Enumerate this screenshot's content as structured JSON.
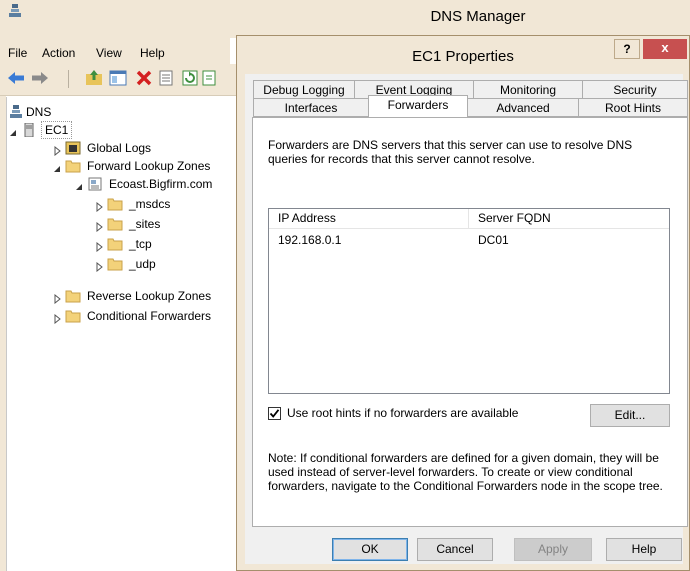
{
  "main_window": {
    "title": "DNS Manager",
    "menu": [
      "File",
      "Action",
      "View",
      "Help"
    ],
    "tree": {
      "root": "DNS",
      "server": "EC1",
      "nodes": [
        {
          "label": "Global Logs",
          "icon": "global-logs-icon"
        },
        {
          "label": "Forward Lookup Zones",
          "icon": "folder-icon"
        },
        {
          "label": "Ecoast.Bigfirm.com",
          "icon": "zone-icon"
        },
        {
          "label": "_msdcs",
          "icon": "folder-icon"
        },
        {
          "label": "_sites",
          "icon": "folder-icon"
        },
        {
          "label": "_tcp",
          "icon": "folder-icon"
        },
        {
          "label": "_udp",
          "icon": "folder-icon"
        },
        {
          "label": "Reverse Lookup Zones",
          "icon": "folder-icon"
        },
        {
          "label": "Conditional Forwarders",
          "icon": "folder-icon"
        }
      ]
    }
  },
  "dialog": {
    "title": "EC1 Properties",
    "help_glyph": "?",
    "close_glyph": "x",
    "tabs_top": [
      "Debug Logging",
      "Event Logging",
      "Monitoring",
      "Security"
    ],
    "tabs_bottom": [
      "Interfaces",
      "Forwarders",
      "Advanced",
      "Root Hints"
    ],
    "active_tab": "Forwarders",
    "description": "Forwarders are DNS servers that this server can use to resolve DNS queries for records that this server cannot resolve.",
    "table": {
      "columns": [
        "IP Address",
        "Server FQDN"
      ],
      "rows": [
        {
          "ip": "192.168.0.1",
          "fqdn": "DC01"
        }
      ]
    },
    "root_hints_checkbox": {
      "label": "Use root hints if no forwarders are available",
      "checked": true
    },
    "edit_button": "Edit...",
    "note": "Note: If conditional forwarders are defined for a given domain, they will be used instead of server-level forwarders.  To create or view conditional forwarders, navigate to the Conditional Forwarders node in the scope tree.",
    "buttons": {
      "ok": "OK",
      "cancel": "Cancel",
      "apply": "Apply",
      "help": "Help"
    }
  },
  "colors": {
    "chrome": "#f1e7d6",
    "close": "#c75050",
    "accent": "#3c7fb1"
  }
}
